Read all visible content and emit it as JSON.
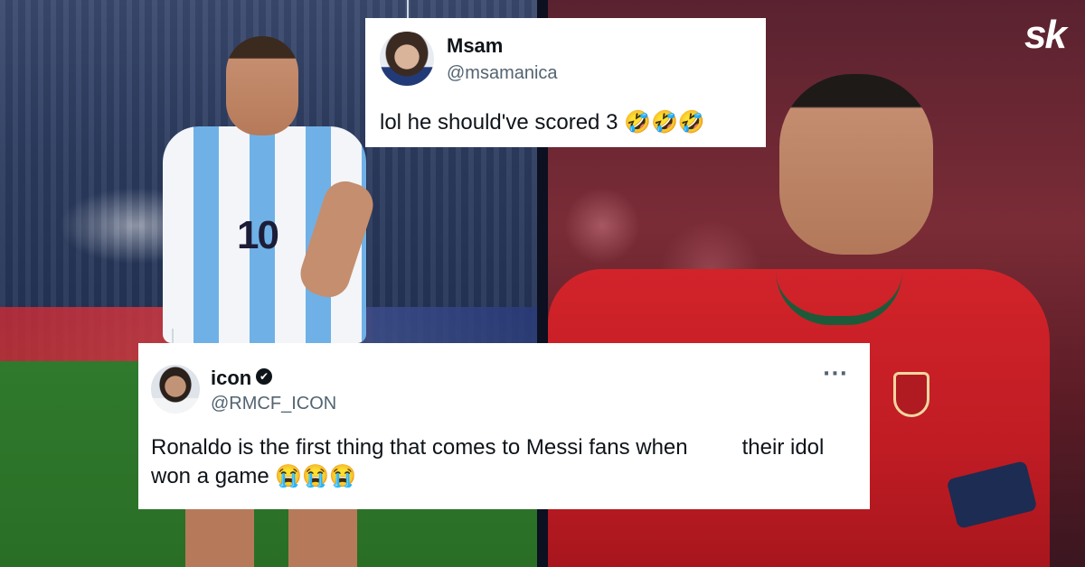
{
  "brand": {
    "logo_text": "sk"
  },
  "tweets": [
    {
      "name": "Msam",
      "handle": "@msamanica",
      "verified": false,
      "text": "lol he should've scored 3 🤣🤣🤣"
    },
    {
      "name": "icon",
      "handle": "@RMCF_ICON",
      "verified": true,
      "verified_glyph": "✔",
      "more_glyph": "···",
      "text_part1": "Ronaldo is the first thing that comes to Messi fans when",
      "text_part2": "their idol won a game 😭😭😭"
    }
  ],
  "photos": {
    "left": {
      "shirt_number": "10",
      "kit_colors": [
        "#f3f5f9",
        "#6fb1e6"
      ]
    },
    "right": {
      "kit_colors": [
        "#d2232a",
        "#1d5a3a"
      ]
    }
  },
  "icons": {
    "avatar_left": "avatar-photo",
    "avatar_right": "avatar-photo",
    "verified": "verified-badge-icon",
    "more": "more-options-icon"
  }
}
